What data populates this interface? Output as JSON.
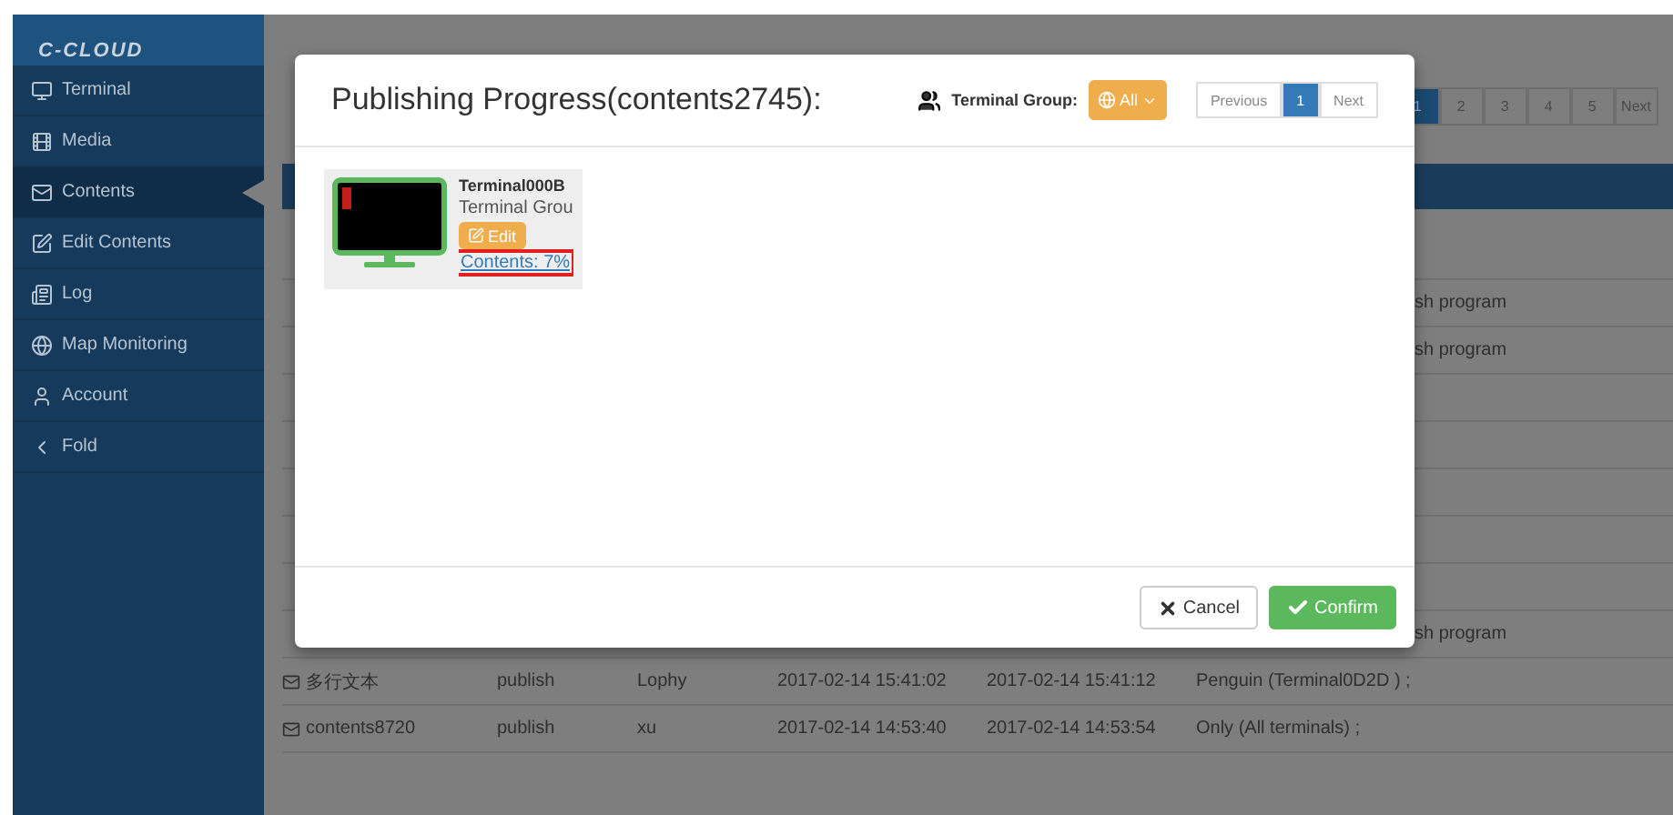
{
  "sidebar": {
    "logo": "C-CLOUD",
    "items": [
      {
        "label": "Terminal",
        "selected": false
      },
      {
        "label": "Media",
        "selected": false
      },
      {
        "label": "Contents",
        "selected": true
      },
      {
        "label": "Edit Contents",
        "selected": false
      },
      {
        "label": "Log",
        "selected": false
      },
      {
        "label": "Map Monitoring",
        "selected": false
      },
      {
        "label": "Account",
        "selected": false
      },
      {
        "label": "Fold",
        "selected": false
      }
    ]
  },
  "pagination": {
    "pages": [
      {
        "label": "1",
        "selected": true
      },
      {
        "label": "2",
        "selected": false
      },
      {
        "label": "3",
        "selected": false
      },
      {
        "label": "4",
        "selected": false
      },
      {
        "label": "5",
        "selected": false
      }
    ],
    "next": "Next"
  },
  "table": {
    "rows": [
      {
        "kind": "covered",
        "tail": ""
      },
      {
        "kind": "covered",
        "tail": "sh program"
      },
      {
        "kind": "covered",
        "tail": "sh program"
      },
      {
        "kind": "covered",
        "tail": ""
      },
      {
        "kind": "covered",
        "tail": ""
      },
      {
        "kind": "covered",
        "tail": ""
      },
      {
        "kind": "covered",
        "tail": ""
      },
      {
        "kind": "covered",
        "tail": ""
      },
      {
        "kind": "covered",
        "tail": "sh program"
      },
      {
        "kind": "full",
        "name": "多行文本",
        "type": "publish",
        "user": "Lophy",
        "start": "2017-02-14 15:41:02",
        "end": "2017-02-14 15:41:12",
        "terminals": "Penguin (Terminal0D2D ) ;"
      },
      {
        "kind": "full",
        "name": "contents8720",
        "type": "publish",
        "user": "xu",
        "start": "2017-02-14 14:53:40",
        "end": "2017-02-14 14:53:54",
        "terminals": "Only (All terminals) ;"
      }
    ]
  },
  "modal": {
    "title": "Publishing Progress(contents2745):",
    "group_label": "Terminal Group:",
    "group_value": "All",
    "previous": "Previous",
    "page": {
      "label": "1",
      "selected": true
    },
    "next": "Next",
    "terminals": [
      {
        "name": "Terminal000B",
        "group": "Terminal Grou",
        "edit": "Edit",
        "progress": "Contents: 7%",
        "highlighted": true
      }
    ],
    "cancel": "Cancel",
    "confirm": "Confirm"
  }
}
